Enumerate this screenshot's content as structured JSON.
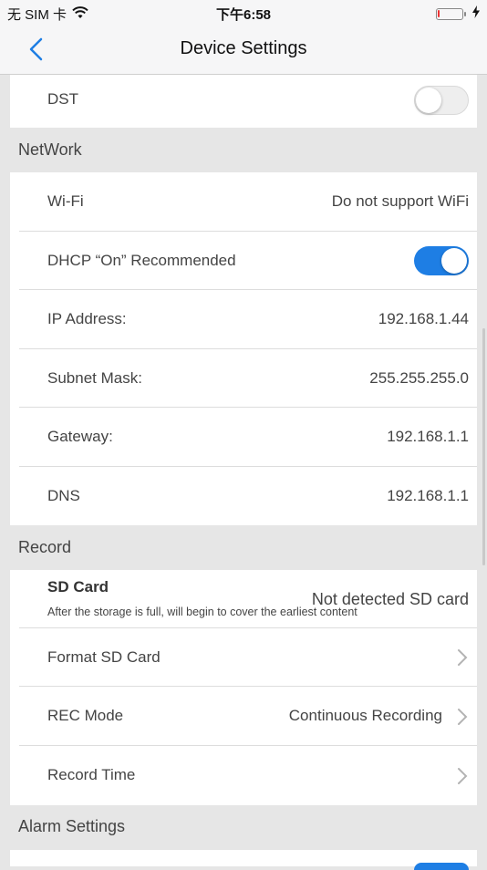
{
  "status": {
    "carrier": "无 SIM 卡",
    "time": "下午6:58",
    "battery_level": 0.1,
    "icons": [
      "wifi-icon",
      "battery-icon",
      "charging-bolt-icon"
    ]
  },
  "nav": {
    "title": "Device Settings",
    "back_icon": "chevron-left-icon"
  },
  "dst": {
    "label": "DST",
    "enabled": false
  },
  "network": {
    "header": "NetWork",
    "wifi_label": "Wi-Fi",
    "wifi_value": "Do not support WiFi",
    "dhcp_label": "DHCP “On” Recommended",
    "dhcp_enabled": true,
    "ip_label": "IP Address:",
    "ip_value": "192.168.1.44",
    "subnet_label": "Subnet Mask:",
    "subnet_value": "255.255.255.0",
    "gateway_label": "Gateway:",
    "gateway_value": "192.168.1.1",
    "dns_label": "DNS",
    "dns_value": "192.168.1.1"
  },
  "record": {
    "header": "Record",
    "sd_label": "SD Card",
    "sd_note": "After the storage is full, will begin to cover the earliest content",
    "sd_value": "Not detected SD card",
    "format_label": "Format SD Card",
    "rec_mode_label": "REC Mode",
    "rec_mode_value": "Continuous Recording",
    "record_time_label": "Record Time"
  },
  "alarm": {
    "header": "Alarm Settings"
  },
  "colors": {
    "accent": "#1e7ee4",
    "background": "#e6e6e6",
    "nav_background": "#f6f6f7"
  }
}
